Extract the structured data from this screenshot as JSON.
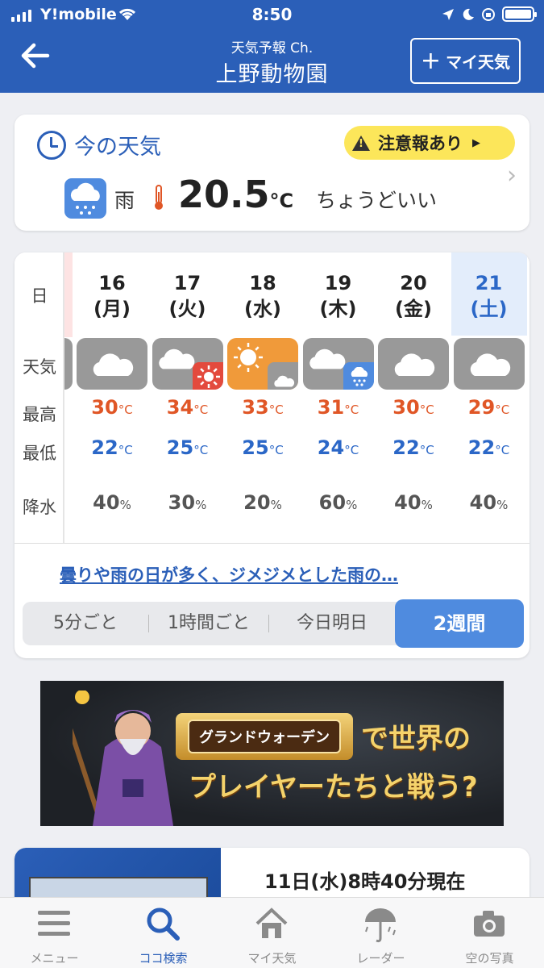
{
  "status": {
    "carrier": "Y!mobile",
    "time": "8:50"
  },
  "header": {
    "subtitle": "天気予報 Ch.",
    "title": "上野動物園",
    "my_weather_label": "マイ天気",
    "my_weather_plus": "+"
  },
  "current": {
    "heading": "今の天気",
    "alert": "注意報あり",
    "condition": "雨",
    "temperature": "20.5",
    "unit": "°C",
    "feel": "ちょうどいい"
  },
  "forecast": {
    "row_labels": {
      "day": "日",
      "weather": "天気",
      "high": "最高",
      "low": "最低",
      "precip": "降水"
    },
    "temp_unit": "°C",
    "precip_unit": "%",
    "days": [
      {
        "date": "16",
        "weekday": "(月)",
        "weather": "cloudy",
        "high": "30",
        "low": "22",
        "precip": "40"
      },
      {
        "date": "17",
        "weekday": "(火)",
        "weather": "cloudy-then-sunny",
        "high": "34",
        "low": "25",
        "precip": "30"
      },
      {
        "date": "18",
        "weekday": "(水)",
        "weather": "sunny-then-cloudy",
        "high": "33",
        "low": "25",
        "precip": "20"
      },
      {
        "date": "19",
        "weekday": "(木)",
        "weather": "cloudy-then-rain",
        "high": "31",
        "low": "24",
        "precip": "60"
      },
      {
        "date": "20",
        "weekday": "(金)",
        "weather": "cloudy",
        "high": "30",
        "low": "22",
        "precip": "40"
      },
      {
        "date": "21",
        "weekday": "(土)",
        "weather": "cloudy",
        "high": "29",
        "low": "22",
        "precip": "40"
      }
    ],
    "comment": "曇りや雨の日が多く、ジメジメとした雨の…",
    "tabs": [
      "5分ごと",
      "1時間ごと",
      "今日明日",
      "2週間"
    ],
    "active_tab": "2週間"
  },
  "ad": {
    "banner": "グランドウォーデン",
    "line1": "で世界の",
    "line2": "プレイヤーたちと戦う?"
  },
  "news": {
    "headline": "11日(水)8時40分現在"
  },
  "tabbar": [
    {
      "label": "メニュー",
      "icon": "menu-icon"
    },
    {
      "label": "ココ検索",
      "icon": "search-icon"
    },
    {
      "label": "マイ天気",
      "icon": "home-icon"
    },
    {
      "label": "レーダー",
      "icon": "umbrella-icon"
    },
    {
      "label": "空の写真",
      "icon": "camera-icon"
    }
  ],
  "colors": {
    "brand": "#2b5fb8",
    "high": "#e05626",
    "low": "#2b67c7",
    "alert": "#fce65a",
    "sunny": "#f09a3a",
    "rain": "#4f8bdf"
  }
}
